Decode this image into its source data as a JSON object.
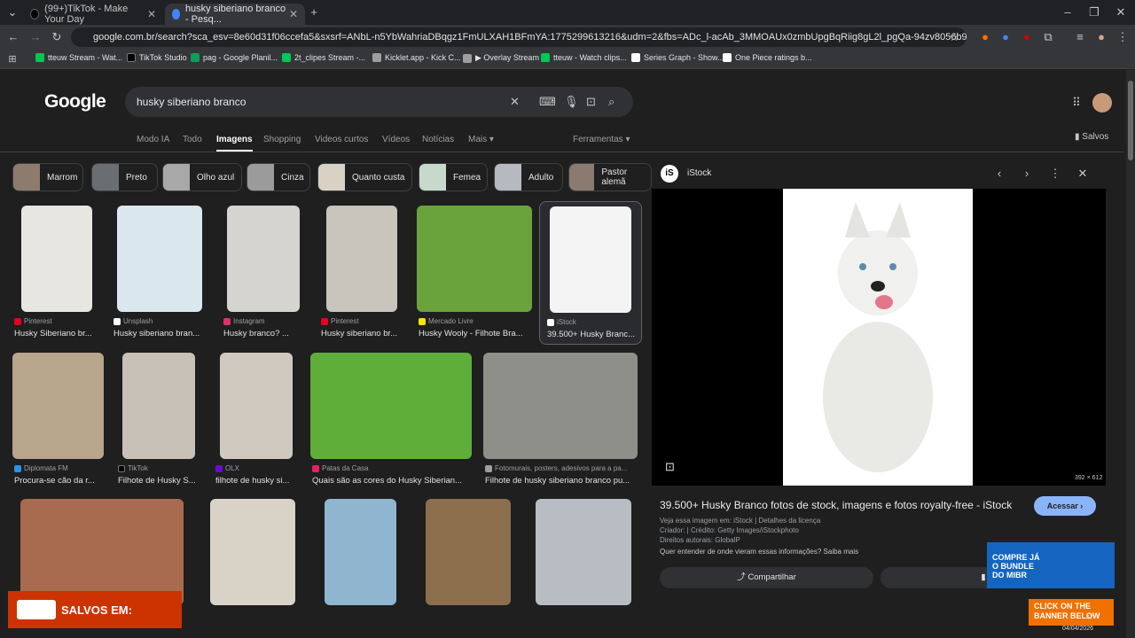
{
  "tabs": [
    {
      "label": "(99+)TikTok - Make Your Day",
      "color": "#000000"
    },
    {
      "label": "husky siberiano branco - Pesq...",
      "color": "#4285f4"
    }
  ],
  "address": "google.com.br/search?sca_esv=8e60d31f06ccefa5&sxsrf=ANbL-n5YbWahriaDBqgz1FmULXAH1BFmYA:1775299613216&udm=2&fbs=ADc_l-acAb_3MMOAUx0zmbUpgBqRiig8gL2l_pgQa-94zv8056b93wKmVeAAORa3GlNFZT7EtWOj...",
  "bookmarks": [
    {
      "label": "tteuw Stream - Wat...",
      "color": "#00c853"
    },
    {
      "label": "TikTok Studio",
      "color": "#000000"
    },
    {
      "label": "pag - Google Planil...",
      "color": "#0f9d58"
    },
    {
      "label": "2t_clipes Stream -...",
      "color": "#00c853"
    },
    {
      "label": "Kicklet.app - Kick C...",
      "color": "#9e9e9e"
    },
    {
      "label": "▶ Overlay Stream",
      "color": "#9e9e9e"
    },
    {
      "label": "tteuw - Watch clips...",
      "color": "#00c853"
    },
    {
      "label": "Series Graph - Show...",
      "color": "#ffffff"
    },
    {
      "label": "One Piece ratings b...",
      "color": "#ffffff"
    }
  ],
  "google": {
    "logo": "Google",
    "query": "husky siberiano branco",
    "nav": [
      "Modo IA",
      "Todo",
      "Imagens",
      "Shopping",
      "Videos curtos",
      "Vídeos",
      "Notícias",
      "Mais ▾",
      "Ferramentas ▾"
    ],
    "saved": "Salvos"
  },
  "chips": [
    "Marrom",
    "Preto",
    "Olho azul",
    "Cinza",
    "Quanto custa",
    "Femea",
    "Adulto",
    "Pastor alemã"
  ],
  "results_row1": [
    {
      "source": "Pinterest",
      "title": "Husky Siberiano br...",
      "color": "#e60023"
    },
    {
      "source": "Unsplash",
      "title": "Husky siberiano bran...",
      "color": "#ffffff"
    },
    {
      "source": "Instagram",
      "title": "Husky branco? ...",
      "color": "#e1306c"
    },
    {
      "source": "Pinterest",
      "title": "Husky siberiano br...",
      "color": "#e60023"
    },
    {
      "source": "Mercado Livre",
      "title": "Husky Wooly - Filhote Bra...",
      "color": "#ffe600"
    },
    {
      "source": "iStock",
      "title": "39.500+ Husky Branc...",
      "color": "#ffffff"
    }
  ],
  "results_row2": [
    {
      "source": "Diplomata FM",
      "title": "Procura-se cão da r...",
      "color": "#2196f3"
    },
    {
      "source": "TikTok",
      "title": "Filhote de Husky S...",
      "color": "#000000"
    },
    {
      "source": "OLX",
      "title": "filhote de husky si...",
      "color": "#6e0ad6"
    },
    {
      "source": "Patas da Casa",
      "title": "Quais são as cores do Husky Siberian...",
      "color": "#e91e63"
    },
    {
      "source": "Fotomurais, posters, adesivos para a pa...",
      "title": "Filhote de husky siberiano branco pu...",
      "color": "#9e9e9e"
    }
  ],
  "panel": {
    "site": "iStock",
    "size": "392 × 612",
    "title": "39.500+ Husky Branco fotos de stock, imagens e fotos royalty-free - iStock",
    "visit": "Acessar ›",
    "line1": "Veja essa imagem em: iStock | Detalhes da licença",
    "line2": "Criador: | Crédito: Getty Images/iStockphoto",
    "line3": "Direitos autorais: GlobalP",
    "line4": "Quer entender de onde vieram essas informações? Saiba mais",
    "share": "Compartilhar",
    "save": "S"
  },
  "overlay": {
    "saved_in": "SALVOS EM:",
    "ad_text": "COMPRE JÁ O BUNDLE DO MIBR",
    "cta": "CLICK ON THE BANNER BELOW"
  },
  "clock": {
    "time": "47",
    "date": "04/04/2026"
  }
}
